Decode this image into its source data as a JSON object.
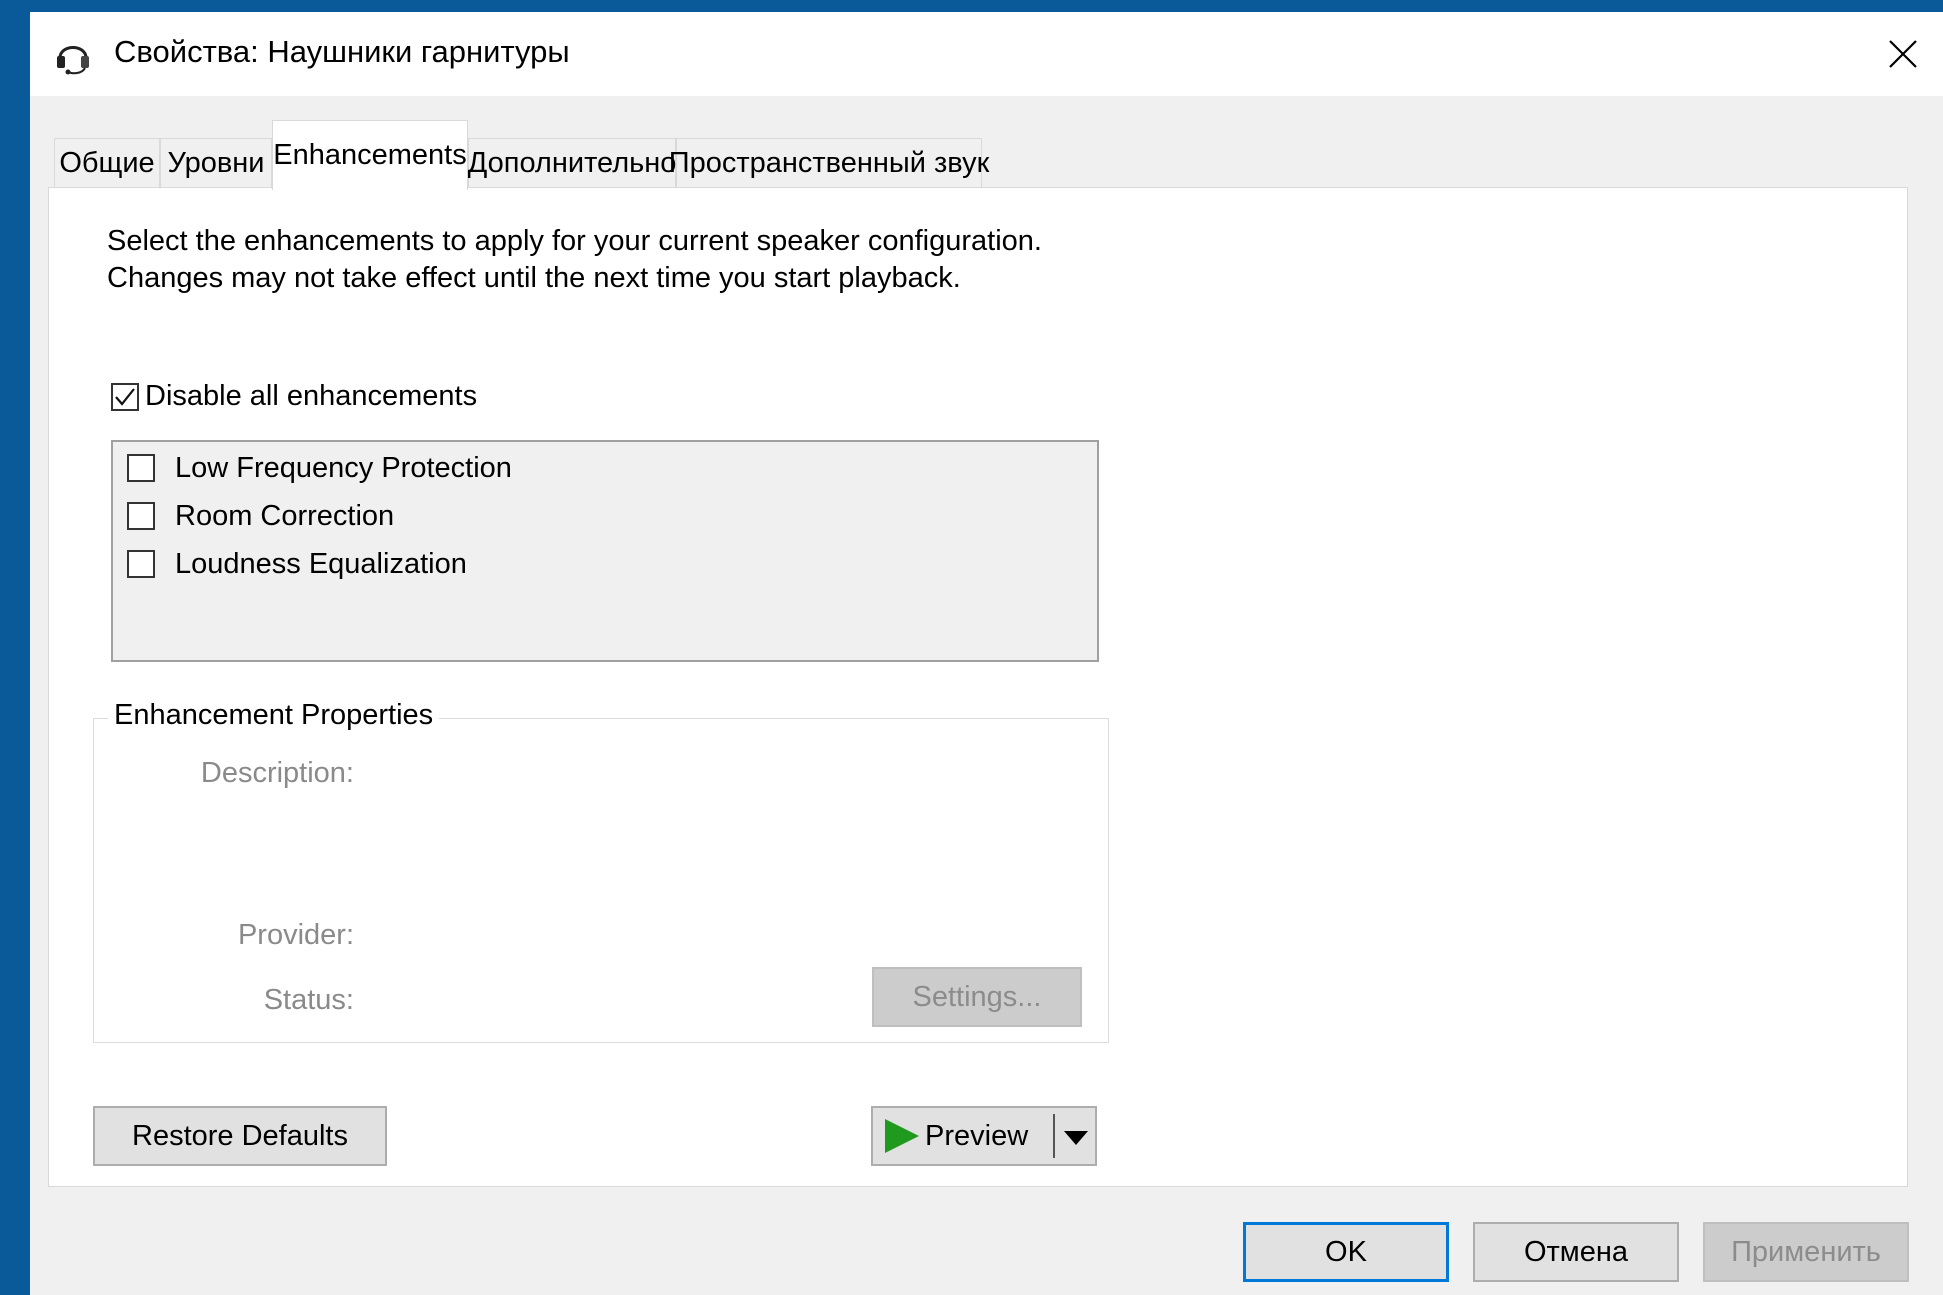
{
  "window": {
    "title": "Свойства: Наушники гарнитуры",
    "icon": "headset-icon"
  },
  "tabs": [
    {
      "label": "Общие",
      "active": false
    },
    {
      "label": "Уровни",
      "active": false
    },
    {
      "label": "Enhancements",
      "active": true
    },
    {
      "label": "Дополнительно",
      "active": false
    },
    {
      "label": "Пространственный звук",
      "active": false
    }
  ],
  "enhancements": {
    "description": "Select the enhancements to apply for your current speaker configuration. Changes may not take effect until the next time you start playback.",
    "disable_all": {
      "label": "Disable all enhancements",
      "checked": true
    },
    "items": [
      {
        "label": "Low Frequency Protection",
        "checked": false
      },
      {
        "label": "Room Correction",
        "checked": false
      },
      {
        "label": "Loudness Equalization",
        "checked": false
      }
    ]
  },
  "properties": {
    "title": "Enhancement Properties",
    "description_label": "Description:",
    "provider_label": "Provider:",
    "status_label": "Status:",
    "settings_label": "Settings..."
  },
  "actions": {
    "restore_label": "Restore Defaults",
    "preview_label": "Preview"
  },
  "footer": {
    "ok_label": "OK",
    "cancel_label": "Отмена",
    "apply_label": "Применить"
  },
  "colors": {
    "accent": "#0078d7",
    "preview_arrow": "#1f9a1f",
    "desktop": "#0a5a99"
  }
}
